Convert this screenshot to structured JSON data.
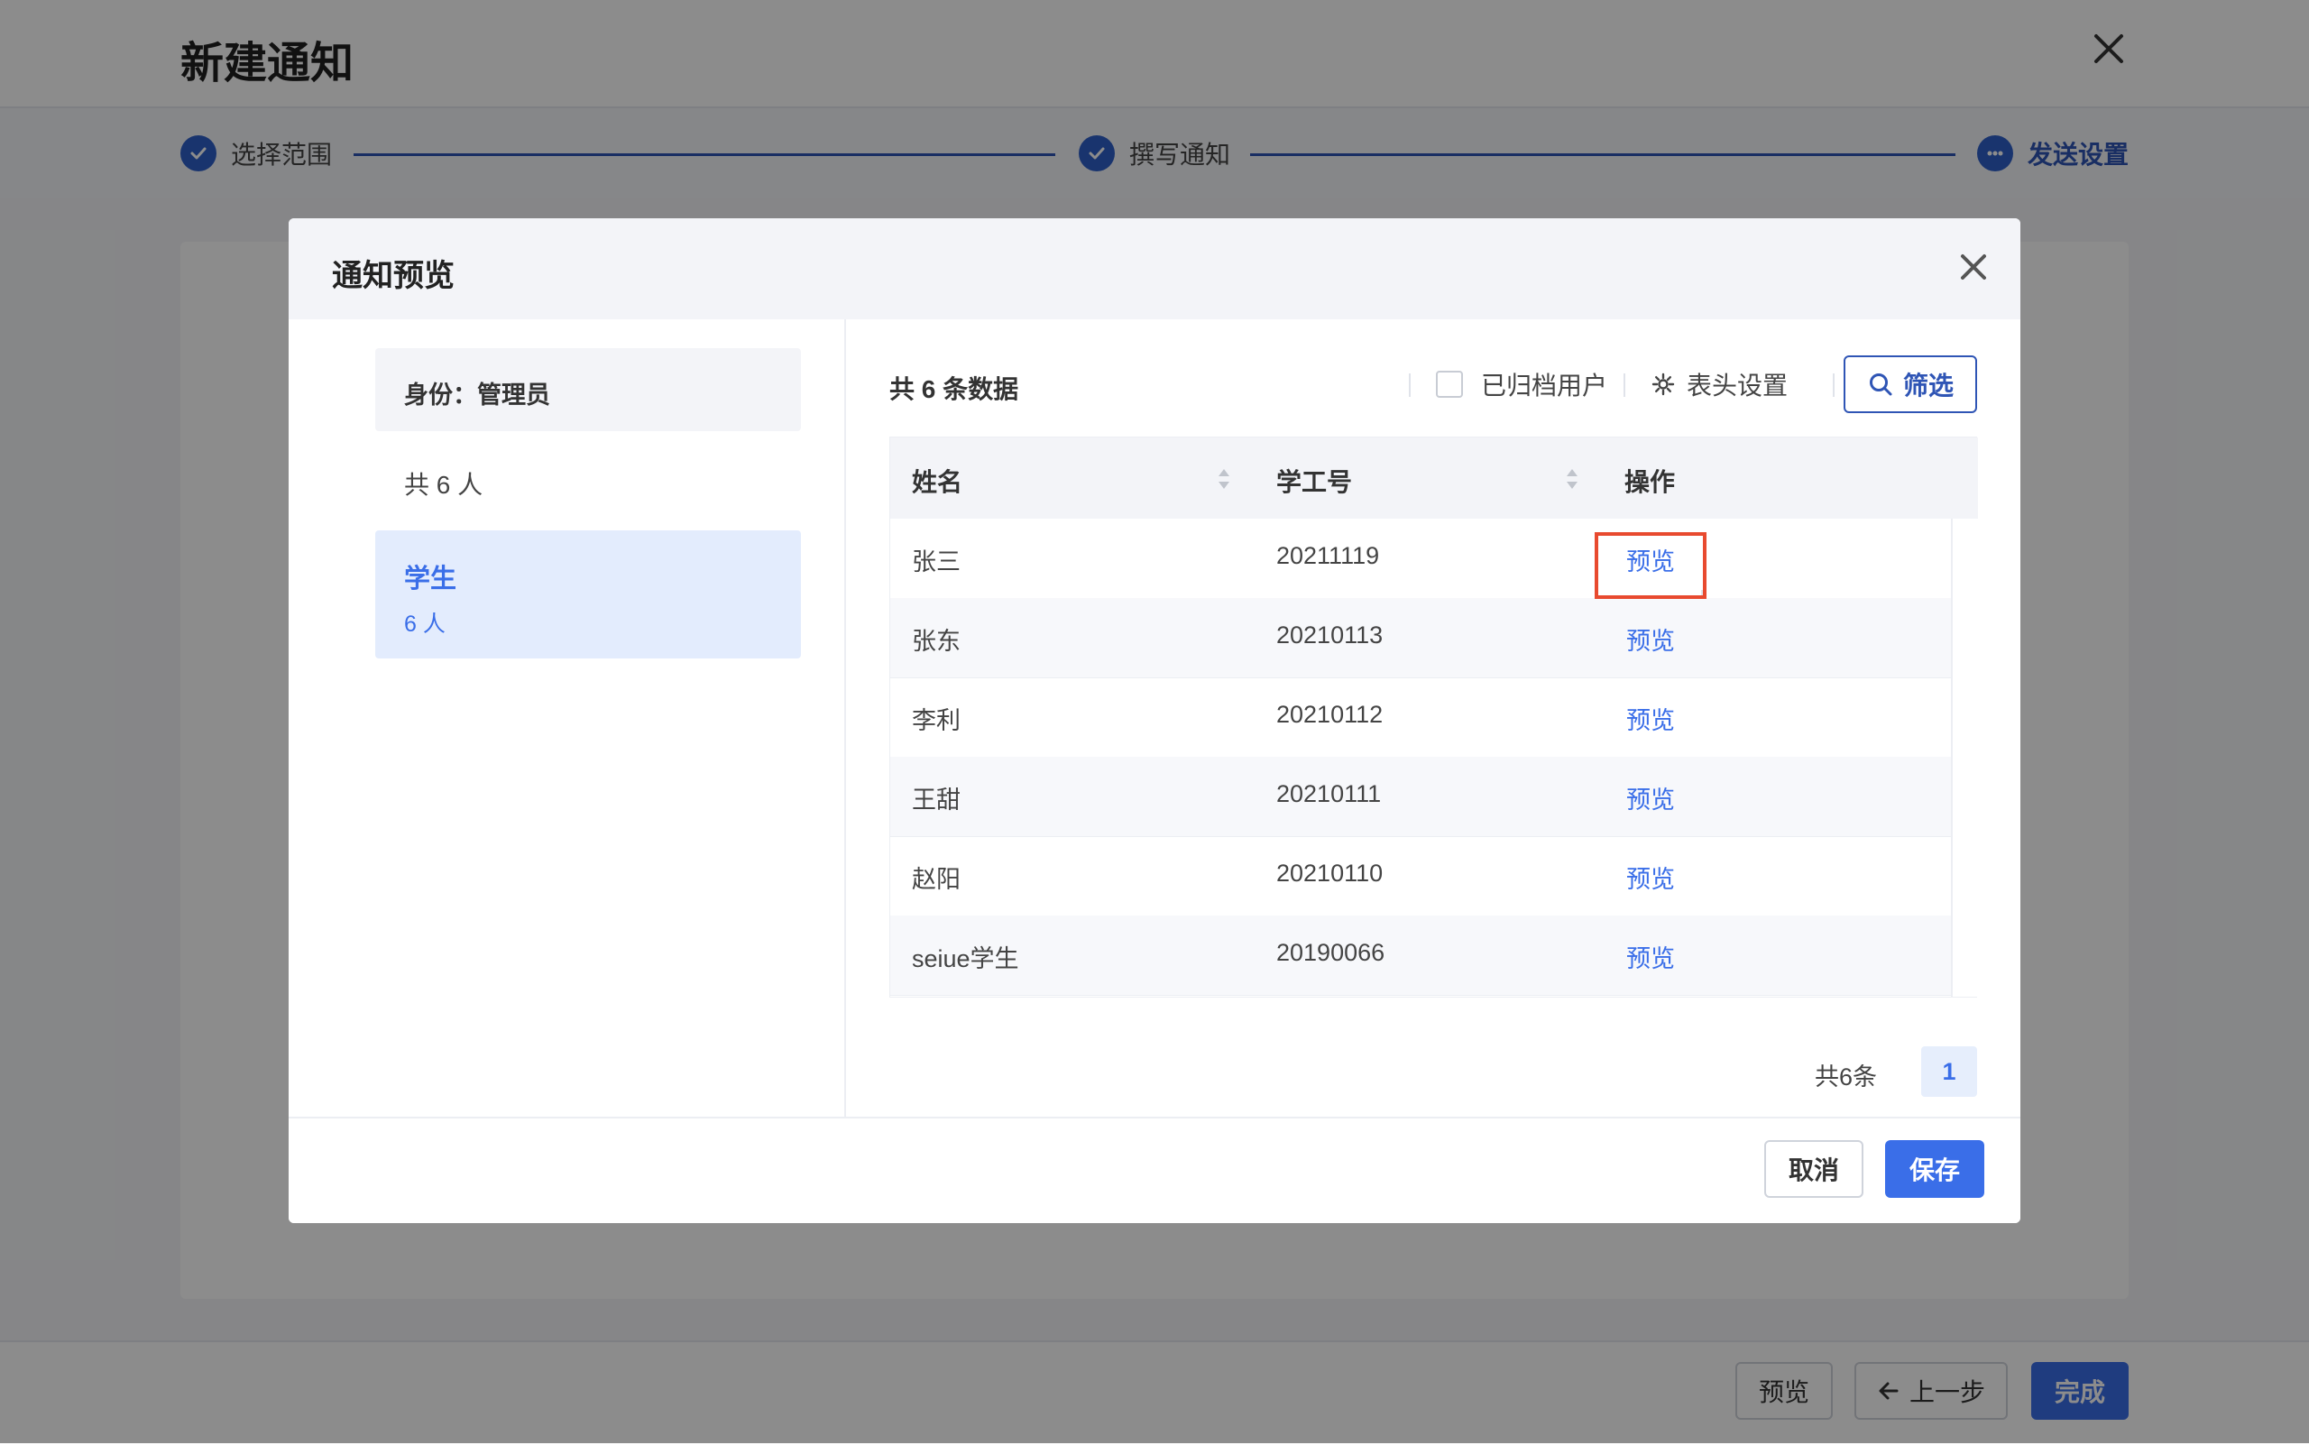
{
  "page": {
    "title": "新建通知",
    "steps": [
      {
        "label": "选择范围",
        "status": "done"
      },
      {
        "label": "撰写通知",
        "status": "done"
      },
      {
        "label": "发送设置",
        "status": "active"
      }
    ],
    "footer": {
      "preview_label": "预览",
      "prev_label": "上一步",
      "finish_label": "完成"
    }
  },
  "modal": {
    "title": "通知预览",
    "left": {
      "role_label": "身份：管理员",
      "total_people": "共 6 人",
      "group": {
        "name": "学生",
        "count": "6 人"
      }
    },
    "toolbar": {
      "data_count": "共 6 条数据",
      "archived_label": "已归档用户",
      "header_settings_label": "表头设置",
      "filter_label": "筛选"
    },
    "table": {
      "columns": [
        "姓名",
        "学工号",
        "操作"
      ],
      "rows": [
        {
          "name": "张三",
          "id": "20211119",
          "action": "预览"
        },
        {
          "name": "张东",
          "id": "20210113",
          "action": "预览"
        },
        {
          "name": "李利",
          "id": "20210112",
          "action": "预览"
        },
        {
          "name": "王甜",
          "id": "20210111",
          "action": "预览"
        },
        {
          "name": "赵阳",
          "id": "20210110",
          "action": "预览"
        },
        {
          "name": "seiue学生",
          "id": "20190066",
          "action": "预览"
        }
      ]
    },
    "pagination": {
      "total_label": "共6条",
      "current_page": "1"
    },
    "footer": {
      "cancel_label": "取消",
      "save_label": "保存"
    }
  },
  "colors": {
    "primary": "#3a6ee8",
    "step_blue": "#2f55b5",
    "highlight": "#e84a2f"
  }
}
